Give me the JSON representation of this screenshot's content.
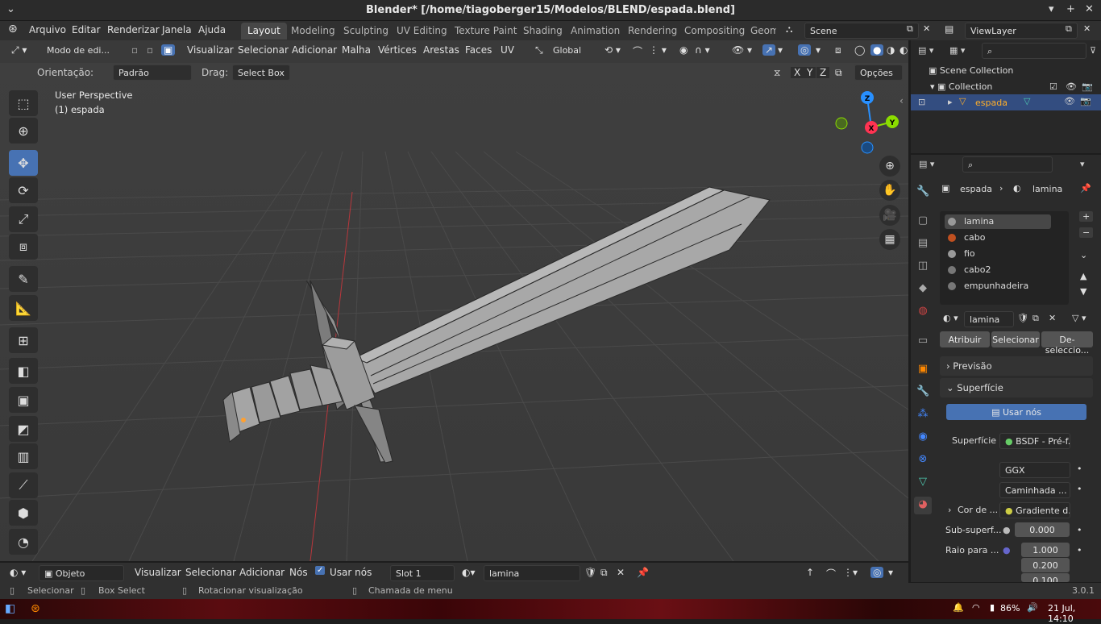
{
  "window": {
    "title": "Blender* [/home/tiagoberger15/Modelos/BLEND/espada.blend]",
    "minimize": "▾",
    "restore": "▴",
    "maximize": "+",
    "close": "✕"
  },
  "menus": [
    "Arquivo",
    "Editar",
    "Renderizar",
    "Janela",
    "Ajuda"
  ],
  "workspaces": [
    "Layout",
    "Modeling",
    "Sculpting",
    "UV Editing",
    "Texture Paint",
    "Shading",
    "Animation",
    "Rendering",
    "Compositing",
    "Geom"
  ],
  "scene": {
    "name": "Scene"
  },
  "viewlayer": {
    "name": "ViewLayer"
  },
  "header": {
    "mode": "Modo de edi...",
    "menus": [
      "Visualizar",
      "Selecionar",
      "Adicionar",
      "Malha",
      "Vértices",
      "Arestas",
      "Faces",
      "UV"
    ],
    "transform": "Global"
  },
  "header2": {
    "orient_label": "Orientação:",
    "orient_value": "Padrão",
    "drag_label": "Drag:",
    "drag_value": "Select Box",
    "options": "Opções",
    "axes": [
      "X",
      "Y",
      "Z"
    ]
  },
  "viewport": {
    "perspective": "User Perspective",
    "object": "(1) espada"
  },
  "gizmo": {
    "x": "X",
    "y": "Y",
    "z": "Z"
  },
  "outliner": {
    "scene_collection": "Scene Collection",
    "collection": "Collection",
    "object": "espada"
  },
  "properties": {
    "breadcrumb_object": "espada",
    "breadcrumb_material": "lamina",
    "slots": [
      "lamina",
      "cabo",
      "fio",
      "cabo2",
      "empunhadeira"
    ],
    "material_name": "lamina",
    "assign": "Atribuir",
    "select": "Selecionar",
    "deselect": "De-seleccio...",
    "preview": "Previsão",
    "surface": "Superfície",
    "use_nodes": "Usar nós",
    "surface_label": "Superfície",
    "surface_value": "BSDF - Pré-f...",
    "distribution": "GGX",
    "subsurface_method": "Caminhada ...",
    "base_color_label": "Cor de ...",
    "base_color_value": "Gradiente d...",
    "subsurface_label": "Sub-superf...",
    "subsurface_value": "0.000",
    "radius_label": "Raio para ...",
    "radius_values": [
      "1.000",
      "0.200",
      "0.100"
    ]
  },
  "bottom": {
    "mode": "Objeto",
    "menus": [
      "Visualizar",
      "Selecionar",
      "Adicionar",
      "Nós"
    ],
    "use_nodes": "Usar nós",
    "slot": "Slot 1",
    "material": "lamina"
  },
  "status": {
    "select": "Selecionar",
    "box_select": "Box Select",
    "rotate": "Rotacionar visualização",
    "menu": "Chamada de menu",
    "version": "3.0.1"
  },
  "taskbar": {
    "battery": "86%",
    "datetime": "21 Jul, 14:10"
  },
  "colors": {
    "accent": "#4772b3",
    "x_axis": "#ff3352",
    "y_axis": "#8bdc00",
    "z_axis": "#2890ff",
    "selected_text": "#ffaf29"
  }
}
